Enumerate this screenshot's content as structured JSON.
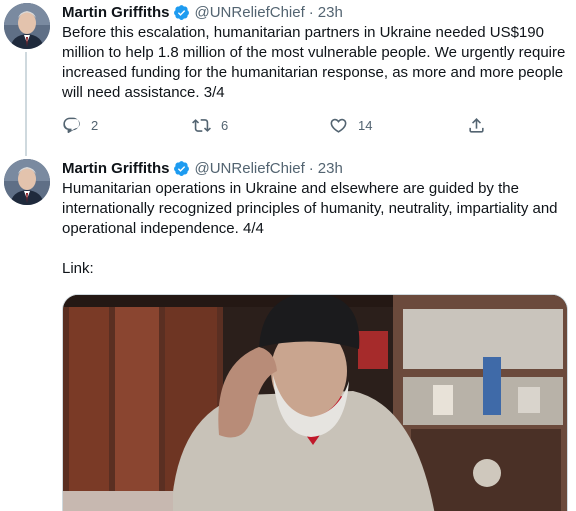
{
  "tweets": [
    {
      "author": {
        "name": "Martin Griffiths",
        "handle": "@UNReliefChief",
        "verified": true
      },
      "time": "23h",
      "separator": "·",
      "text": "Before this escalation, humanitarian partners in Ukraine needed US$190 million to help 1.8 million of the most vulnerable people. We urgently require increased funding for the humanitarian response, as more and more people will need assistance. 3/4",
      "actions": {
        "reply_count": "2",
        "retweet_count": "6",
        "like_count": "14"
      },
      "icons": [
        "reply-icon",
        "retweet-icon",
        "like-icon",
        "share-icon"
      ]
    },
    {
      "author": {
        "name": "Martin Griffiths",
        "handle": "@UNReliefChief",
        "verified": true
      },
      "time": "23h",
      "separator": "·",
      "text": "Humanitarian operations in Ukraine and elsewhere are guided by the internationally recognized principles of humanity, neutrality, impartiality and operational independence. 4/4",
      "link_label": "Link:"
    }
  ],
  "colors": {
    "verified": "#1d9bf0",
    "secondary_text": "#536471",
    "thread_line": "#cfd9de"
  }
}
